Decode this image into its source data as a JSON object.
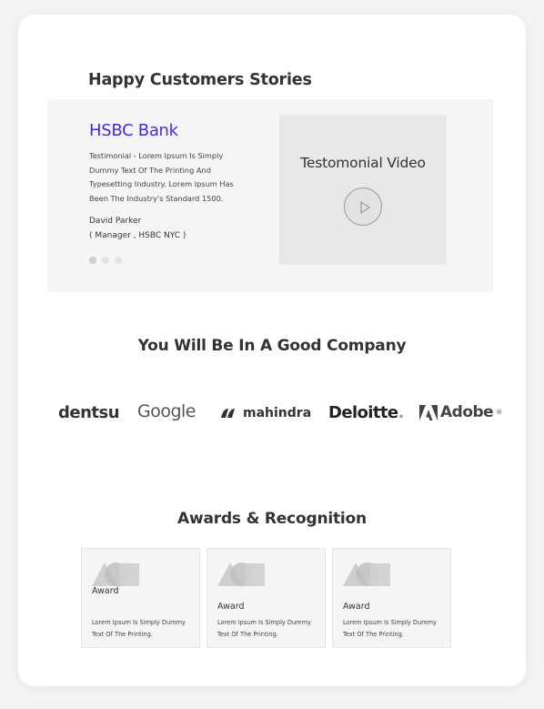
{
  "testimonials": {
    "heading": "Happy Customers Stories",
    "company": "HSBC Bank",
    "quote": "Testimonial - Lorem Ipsum Is Simply Dummy Text Of The Printing And Typesetting Industry. Lorem Ipsum Has Been The Industry's Standard 1500.",
    "author_name": "David Parker",
    "author_role": "( Manager , HSBC NYC )",
    "slide_count": 3,
    "active_slide": 1,
    "video": {
      "title": "Testomonial Video",
      "play_icon": "play-icon"
    }
  },
  "company": {
    "heading": "You Will Be In A Good Company",
    "logos": [
      {
        "name": "dentsu",
        "text": "dentsu"
      },
      {
        "name": "google",
        "text": "Google"
      },
      {
        "name": "mahindra",
        "text": "mahindra"
      },
      {
        "name": "deloitte",
        "text": "Deloitte",
        "suffix": "."
      },
      {
        "name": "adobe",
        "text": "Adobe",
        "suffix": "®"
      }
    ]
  },
  "awards": {
    "heading": "Awards & Recognition",
    "items": [
      {
        "label": "Award",
        "description": "Lorem Ipsum Is Simply Dummy Text Of The Printing."
      },
      {
        "label": "Award",
        "description": "Lorem Ipsum Is Simply Dummy Text Of The Printing."
      },
      {
        "label": "Award",
        "description": "Lorem Ipsum Is Simply Dummy Text Of The Printing."
      }
    ]
  },
  "colors": {
    "accent": "#3d2fd8",
    "page_bg": "#f3f3f3",
    "panel_bg": "#f5f5f5",
    "video_bg": "#e8e8e8"
  }
}
